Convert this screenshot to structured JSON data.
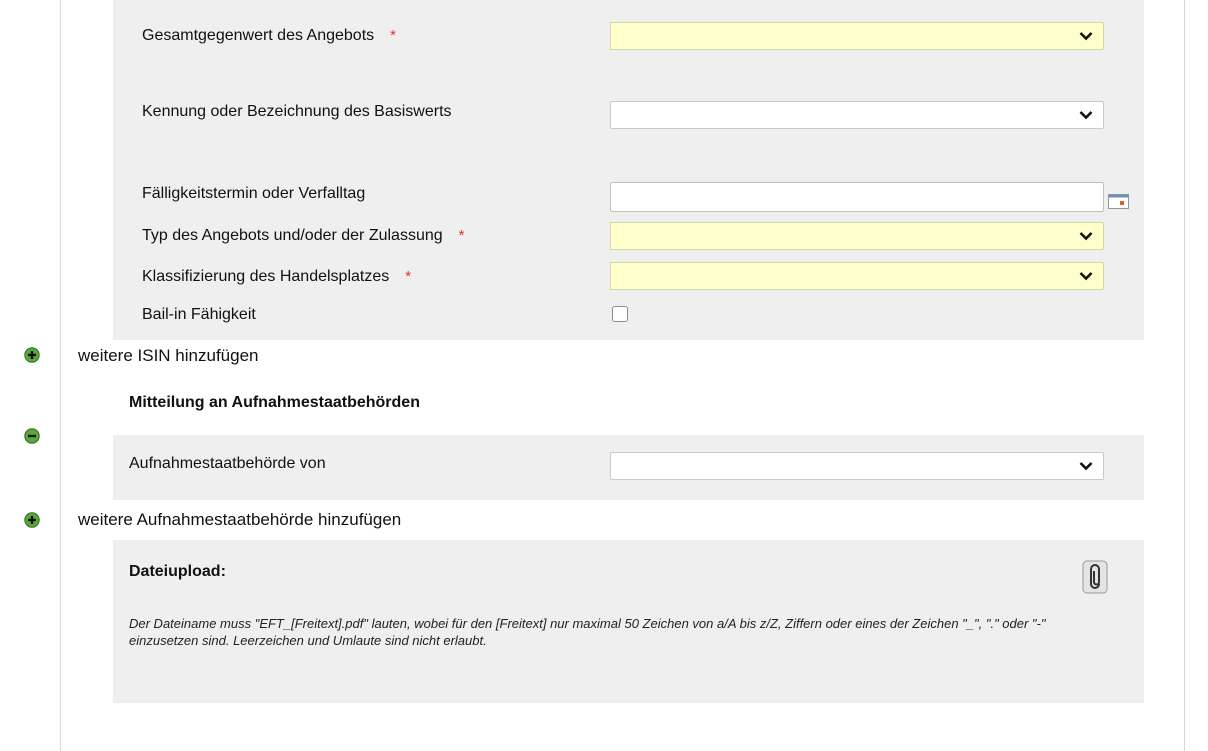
{
  "isin_section": {
    "fields": [
      {
        "label": "Gesamtgegenwert des Angebots",
        "required": "*",
        "value": ""
      },
      {
        "label": "Kennung oder Bezeichnung des Basiswerts",
        "value": ""
      },
      {
        "label": "Fälligkeitstermin oder Verfalltag",
        "value": ""
      },
      {
        "label": "Typ des Angebots und/oder der Zulassung",
        "required": "*",
        "value": ""
      },
      {
        "label": "Klassifizierung des Handelsplatzes",
        "required": "*",
        "value": ""
      },
      {
        "label": "Bail-in Fähigkeit",
        "checked": false
      }
    ],
    "add_link": "weitere ISIN hinzufügen"
  },
  "authority_section": {
    "heading": "Mitteilung an Aufnahmestaatbehörden",
    "field_label": "Aufnahmestaatbehörde von",
    "field_value": "",
    "add_link": "weitere Aufnahmestaatbehörde hinzufügen"
  },
  "upload_section": {
    "heading": "Dateiupload:",
    "note": "Der Dateiname muss \"EFT_[Freitext].pdf\" lauten, wobei für den [Freitext] nur maximal 50 Zeichen von a/A bis z/Z, Ziffern oder eines der Zeichen \"_\", \".\" oder \"-\"  einzusetzen sind. Leerzeichen und Umlaute sind nicht erlaubt."
  },
  "icons": {
    "add": "plus-circle-icon",
    "remove": "minus-circle-icon",
    "attach": "paperclip-icon",
    "calendar": "calendar-icon",
    "dropdown": "chevron-down-icon"
  },
  "colors": {
    "panel_bg": "#efefef",
    "required_field_bg": "#ffffcc",
    "required_marker": "#e0312f",
    "icon_green": "#4a9a2a"
  }
}
